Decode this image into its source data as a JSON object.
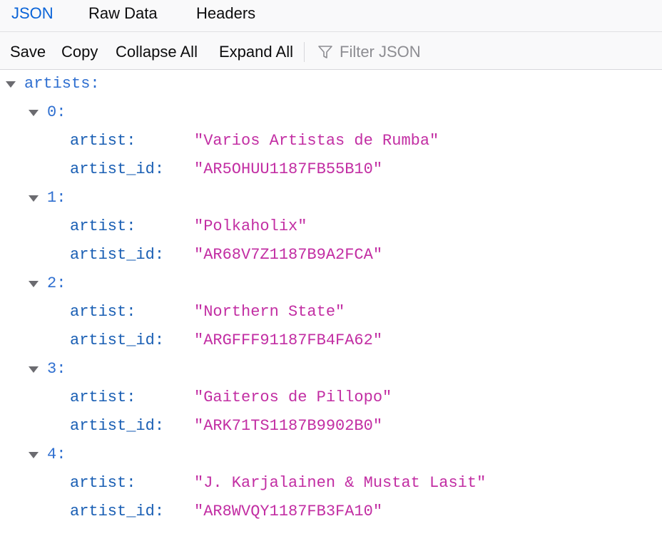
{
  "tabs": [
    {
      "label": "JSON",
      "selected": true
    },
    {
      "label": "Raw Data",
      "selected": false
    },
    {
      "label": "Headers",
      "selected": false
    }
  ],
  "toolbar": {
    "save_label": "Save",
    "copy_label": "Copy",
    "collapse_label": "Collapse All",
    "expand_label": "Expand All",
    "filter_placeholder": "Filter JSON",
    "filter_icon": "filter-icon"
  },
  "tree": {
    "root_key": "artists:",
    "items": [
      {
        "index": "0:",
        "artist_key": "artist:",
        "artist": "\"Varios Artistas de Rumba\"",
        "id_key": "artist_id:",
        "artist_id": "\"AR5OHUU1187FB55B10\""
      },
      {
        "index": "1:",
        "artist_key": "artist:",
        "artist": "\"Polkaholix\"",
        "id_key": "artist_id:",
        "artist_id": "\"AR68V7Z1187B9A2FCA\""
      },
      {
        "index": "2:",
        "artist_key": "artist:",
        "artist": "\"Northern State\"",
        "id_key": "artist_id:",
        "artist_id": "\"ARGFFF91187FB4FA62\""
      },
      {
        "index": "3:",
        "artist_key": "artist:",
        "artist": "\"Gaiteros de Pillopo\"",
        "id_key": "artist_id:",
        "artist_id": "\"ARK71TS1187B9902B0\""
      },
      {
        "index": "4:",
        "artist_key": "artist:",
        "artist": "\"J. Karjalainen & Mustat Lasit\"",
        "id_key": "artist_id:",
        "artist_id": "\"AR8WVQY1187FB3FA10\""
      }
    ]
  },
  "colors": {
    "accent": "#0a64d8",
    "key": "#1a5fb4",
    "string": "#c22ea3"
  }
}
